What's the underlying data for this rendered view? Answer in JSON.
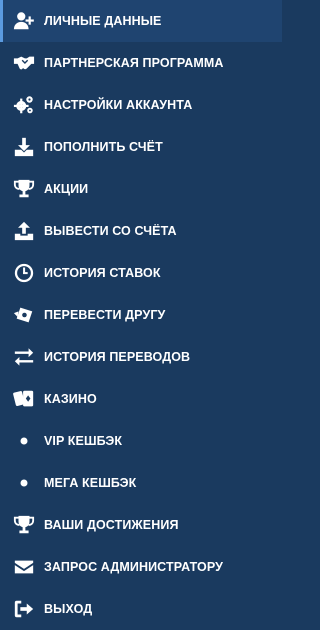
{
  "colors": {
    "background": "#1a3a5f",
    "active_background": "#1f4470",
    "active_border": "#5b9be0",
    "text": "#ffffff"
  },
  "menu": {
    "items": [
      {
        "label": "ЛИЧНЫЕ ДАННЫЕ",
        "icon": "user-add-icon",
        "active": true
      },
      {
        "label": "ПАРТНЕРСКАЯ ПРОГРАММА",
        "icon": "handshake-icon"
      },
      {
        "label": "НАСТРОЙКИ АККАУНТА",
        "icon": "gears-icon"
      },
      {
        "label": "ПОПОЛНИТЬ СЧЁТ",
        "icon": "download-icon"
      },
      {
        "label": "АКЦИИ",
        "icon": "trophy-icon"
      },
      {
        "label": "ВЫВЕСТИ СО СЧЁТА",
        "icon": "upload-icon"
      },
      {
        "label": "ИСТОРИЯ СТАВОК",
        "icon": "clock-icon"
      },
      {
        "label": "ПЕРЕВЕСТИ ДРУГУ",
        "icon": "send-money-icon"
      },
      {
        "label": "ИСТОРИЯ ПЕРЕВОДОВ",
        "icon": "exchange-icon"
      },
      {
        "label": "КАЗИНО",
        "icon": "playing-cards-icon"
      },
      {
        "label": "VIP КЕШБЭК",
        "icon": "dot-icon"
      },
      {
        "label": "МЕГА КЕШБЭК",
        "icon": "dot-icon"
      },
      {
        "label": "ВАШИ ДОСТИЖЕНИЯ",
        "icon": "trophy-icon"
      },
      {
        "label": "ЗАПРОС АДМИНИСТРАТОРУ",
        "icon": "envelope-icon"
      },
      {
        "label": "ВЫХОД",
        "icon": "sign-out-icon"
      }
    ]
  }
}
